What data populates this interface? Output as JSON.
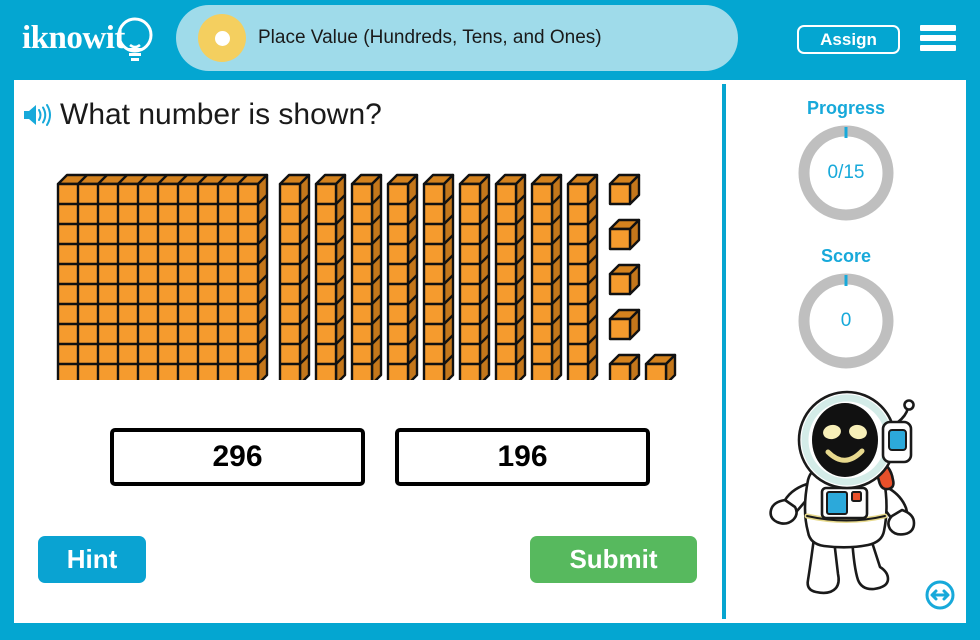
{
  "header": {
    "logo_text": "iknowit",
    "logo_icon": "lightbulb-icon",
    "title": "Place Value (Hundreds, Tens, and Ones)",
    "title_marker_icon": "dot-marker-icon",
    "assign_label": "Assign",
    "menu_icon": "hamburger-menu-icon",
    "bar_color": "#04a6d1",
    "title_pill_color": "#9fdbea",
    "title_dot_color": "#f4cf5f"
  },
  "question": {
    "audio_icon": "speaker-icon",
    "text": "What number is shown?"
  },
  "manipulative": {
    "type": "base-ten-blocks",
    "hundreds": 1,
    "tens": 9,
    "ones": 6,
    "represented_value": 196,
    "block_face_color": "#f59b2e",
    "block_top_color": "#d4821e",
    "block_side_color": "#c4771b",
    "block_outline_color": "#111111",
    "hundreds_grid_rows": 10,
    "hundreds_grid_cols": 10,
    "tens_rod_cubes": 10,
    "ones_layout": "column of 4 plus bottom row of 2"
  },
  "answers": {
    "choices": [
      {
        "label": "296",
        "selected": false
      },
      {
        "label": "196",
        "selected": false
      }
    ]
  },
  "actions": {
    "hint_label": "Hint",
    "hint_color": "#0aa3d2",
    "submit_label": "Submit",
    "submit_color": "#57b95e"
  },
  "sidebar": {
    "progress": {
      "label": "Progress",
      "value": "0/15",
      "completed": 0,
      "total": 15,
      "ring_color": "#bfbfbf",
      "accent_color": "#17a9da"
    },
    "score": {
      "label": "Score",
      "value": "0",
      "points": 0,
      "ring_color": "#bfbfbf",
      "accent_color": "#17a9da"
    },
    "mascot_icon": "astronaut-mascot",
    "fullscreen_icon": "resize-horizontal-icon"
  }
}
